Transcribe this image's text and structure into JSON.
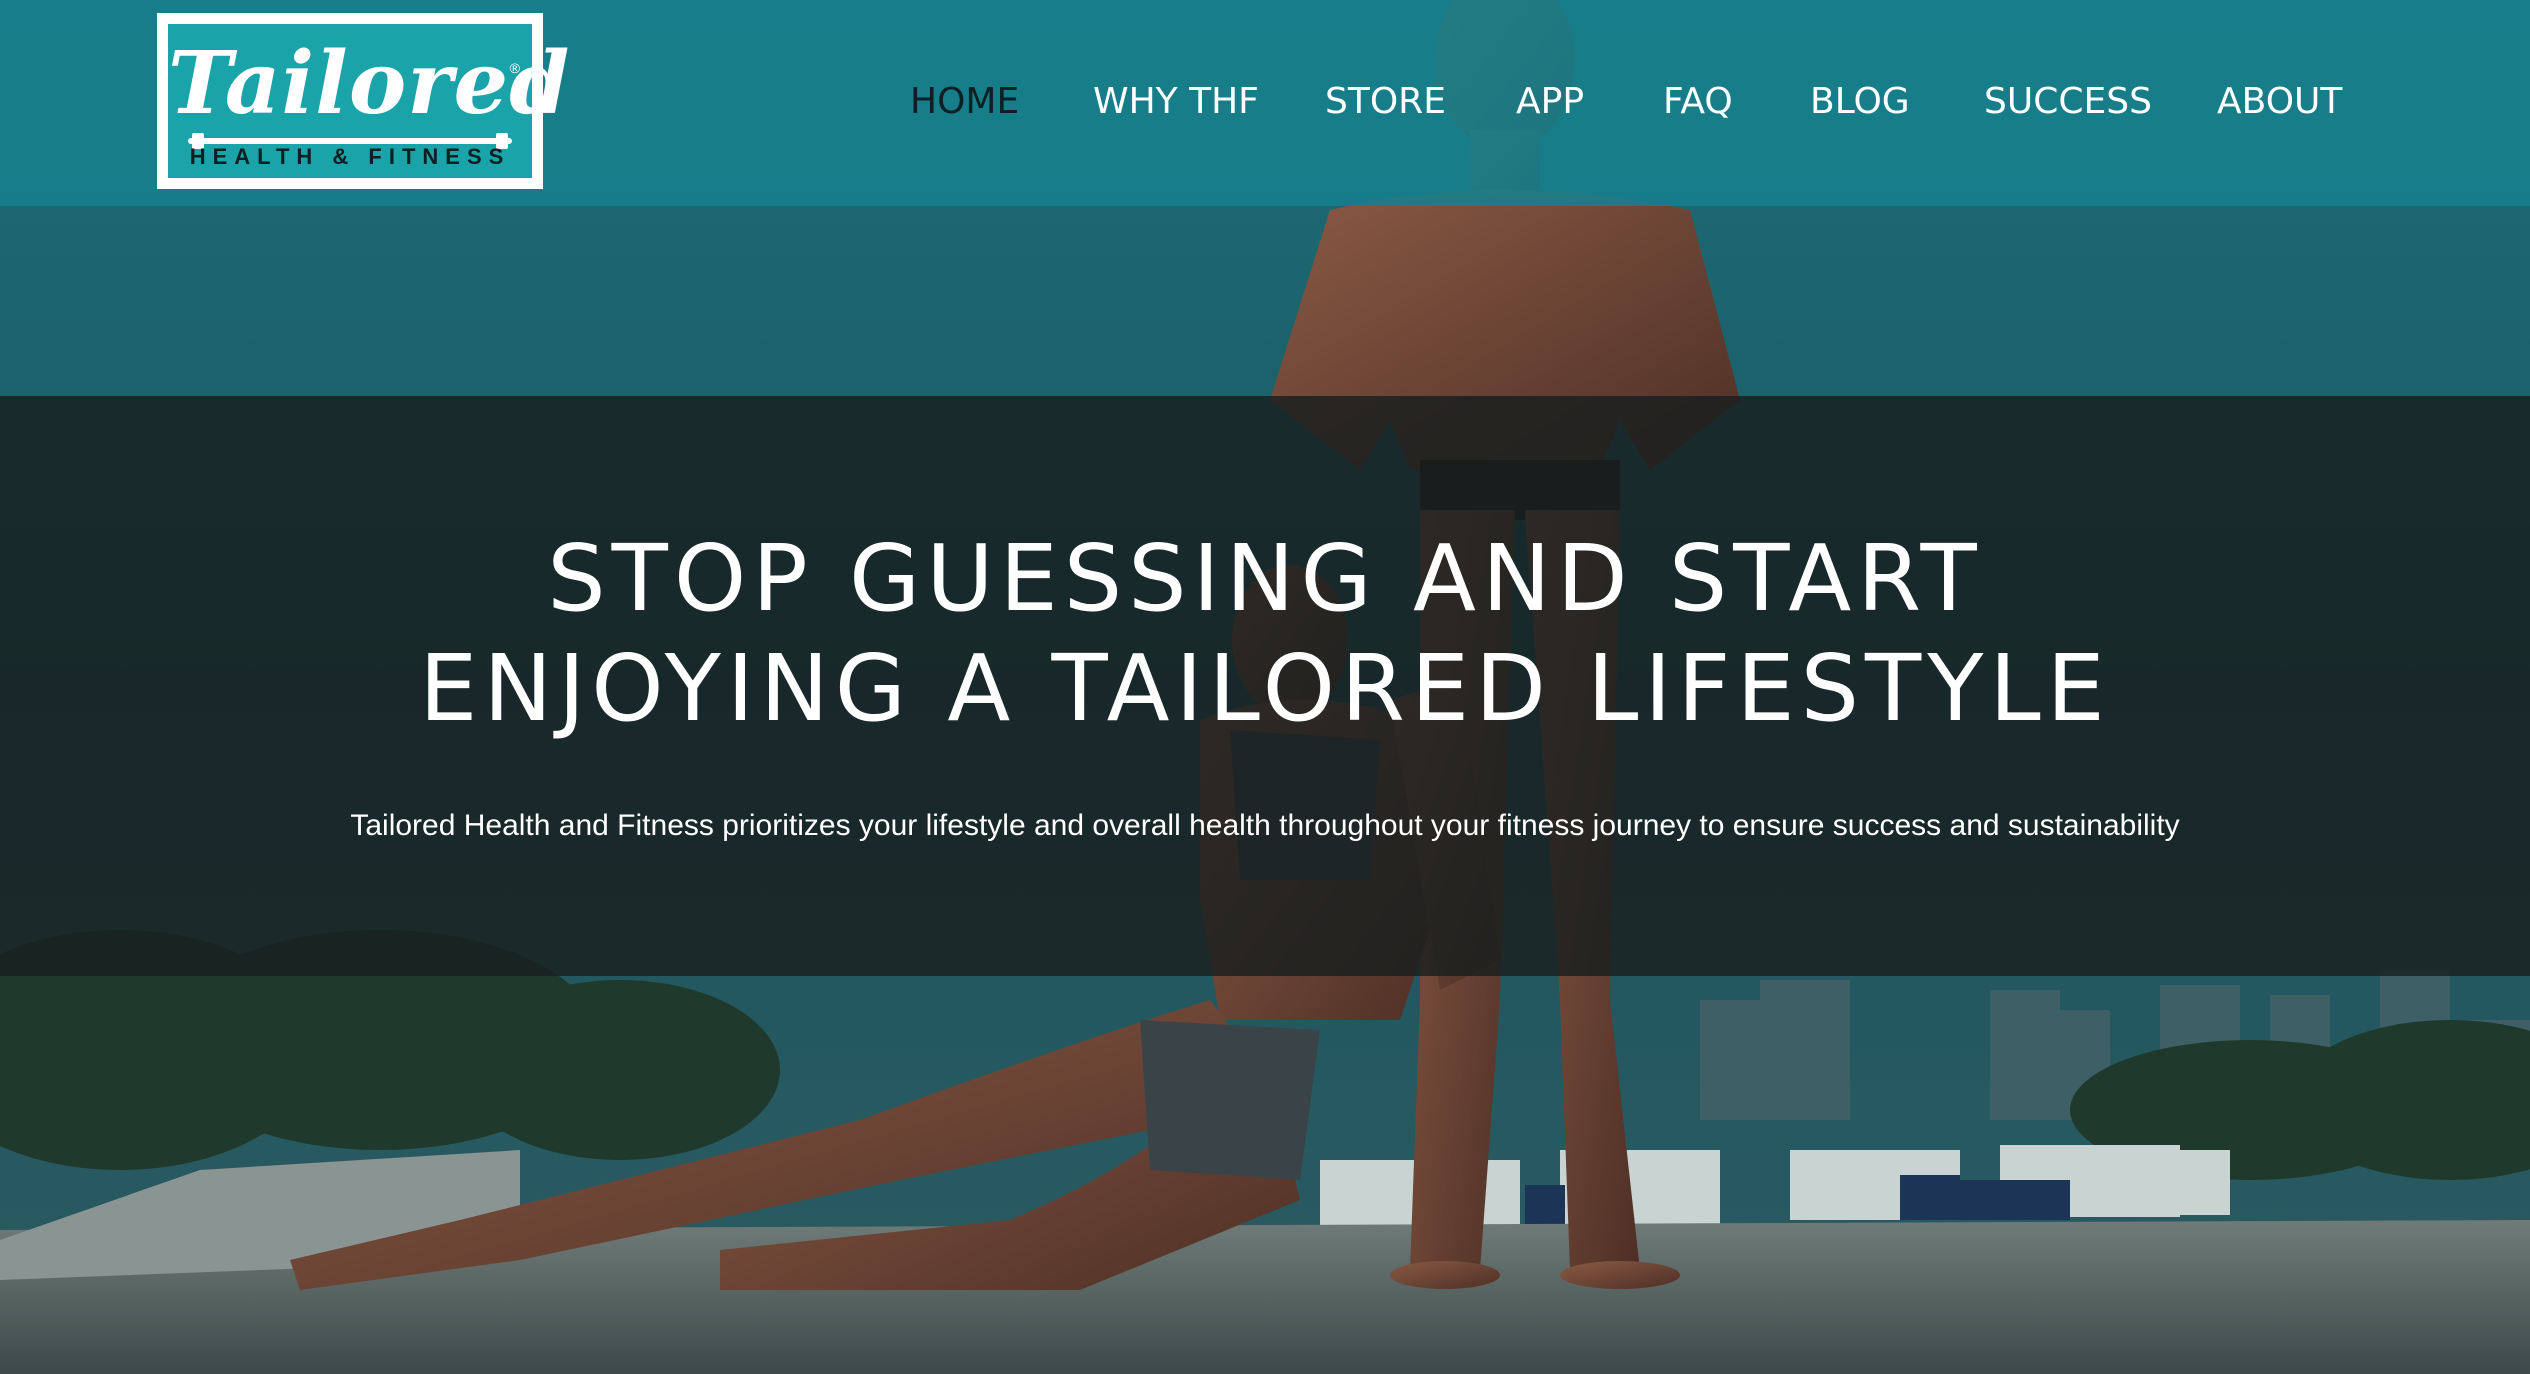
{
  "brand": {
    "script": "Tailored",
    "registered": "®",
    "tagline": "HEALTH & FITNESS",
    "accent_color": "#1aa3a8"
  },
  "nav": {
    "items": [
      {
        "label": "HOME",
        "active": true
      },
      {
        "label": "WHY THF",
        "active": false
      },
      {
        "label": "STORE",
        "active": false
      },
      {
        "label": "APP",
        "active": false
      },
      {
        "label": "FAQ",
        "active": false
      },
      {
        "label": "BLOG",
        "active": false
      },
      {
        "label": "SUCCESS",
        "active": false
      },
      {
        "label": "ABOUT",
        "active": false
      }
    ]
  },
  "hero": {
    "title_line1": "STOP GUESSING AND START",
    "title_line2": "ENJOYING A TAILORED LIFESTYLE",
    "subtitle": "Tailored Health and Fitness prioritizes your lifestyle and overall health throughout your fitness journey to ensure success and sustainability"
  }
}
